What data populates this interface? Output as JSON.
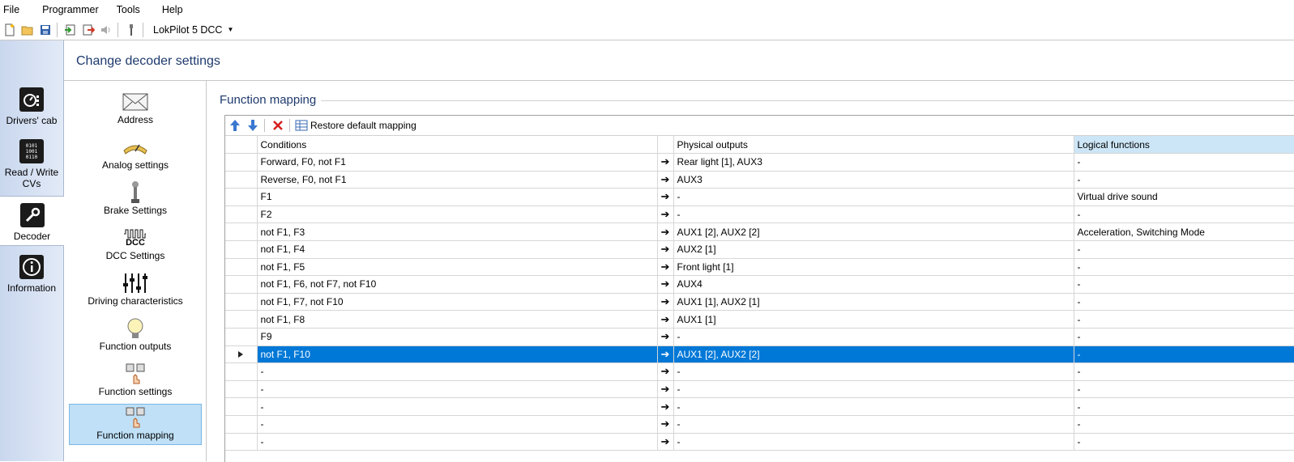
{
  "menu": [
    "File",
    "Programmer",
    "Tools",
    "Help"
  ],
  "toolbar": {
    "decoder_select": "LokPilot 5 DCC",
    "icons": [
      "new-file-icon",
      "open-folder-icon",
      "save-icon",
      "import-icon",
      "export-icon",
      "sound-icon",
      "wrench-probe-icon"
    ]
  },
  "leftnav": {
    "items": [
      {
        "label": "Drivers' cab",
        "icon": "drivers-cab-icon"
      },
      {
        "label": "Read / Write CVs",
        "icon": "binary-icon"
      },
      {
        "label": "Decoder",
        "icon": "wrench-icon"
      },
      {
        "label": "Information",
        "icon": "info-icon"
      }
    ],
    "active": "Decoder"
  },
  "header": {
    "title": "Change decoder settings"
  },
  "categories": [
    {
      "label": "Address",
      "icon": "envelope-icon"
    },
    {
      "label": "Analog settings",
      "icon": "analog-meter-icon"
    },
    {
      "label": "Brake Settings",
      "icon": "brake-lever-icon"
    },
    {
      "label": "DCC Settings",
      "icon": "dcc-icon",
      "icon_text": "DCC"
    },
    {
      "label": "Driving characteristics",
      "icon": "sliders-icon"
    },
    {
      "label": "Function outputs",
      "icon": "lightbulb-icon"
    },
    {
      "label": "Function settings",
      "icon": "function-hand-icon"
    },
    {
      "label": "Function mapping",
      "icon": "function-hand-icon"
    }
  ],
  "selected_category": "Function mapping",
  "section": {
    "title": "Function mapping"
  },
  "grid_toolbar": {
    "restore_label": "Restore default mapping"
  },
  "columns": {
    "conditions": "Conditions",
    "physical": "Physical outputs",
    "logical": "Logical functions"
  },
  "arrow_glyph": "➔",
  "rows": [
    {
      "conditions": "Forward, F0, not F1",
      "physical": "Rear light [1], AUX3",
      "logical": "-"
    },
    {
      "conditions": "Reverse, F0, not F1",
      "physical": "AUX3",
      "logical": "-"
    },
    {
      "conditions": "F1",
      "physical": "-",
      "logical": "Virtual drive sound"
    },
    {
      "conditions": "F2",
      "physical": "-",
      "logical": "-"
    },
    {
      "conditions": "not F1, F3",
      "physical": "AUX1 [2], AUX2 [2]",
      "logical": "Acceleration, Switching Mode"
    },
    {
      "conditions": "not F1, F4",
      "physical": "AUX2 [1]",
      "logical": "-"
    },
    {
      "conditions": "not F1, F5",
      "physical": "Front light [1]",
      "logical": "-"
    },
    {
      "conditions": "not F1, F6, not F7, not F10",
      "physical": "AUX4",
      "logical": "-"
    },
    {
      "conditions": "not F1, F7, not F10",
      "physical": "AUX1 [1], AUX2 [1]",
      "logical": "-"
    },
    {
      "conditions": "not F1, F8",
      "physical": "AUX1 [1]",
      "logical": "-"
    },
    {
      "conditions": "F9",
      "physical": "-",
      "logical": "-"
    },
    {
      "conditions": "not F1, F10",
      "physical": "AUX1 [2], AUX2 [2]",
      "logical": "-",
      "selected": true
    },
    {
      "conditions": "-",
      "physical": "-",
      "logical": "-"
    },
    {
      "conditions": "-",
      "physical": "-",
      "logical": "-"
    },
    {
      "conditions": "-",
      "physical": "-",
      "logical": "-"
    },
    {
      "conditions": "-",
      "physical": "-",
      "logical": "-"
    },
    {
      "conditions": "-",
      "physical": "-",
      "logical": "-"
    }
  ],
  "colors": {
    "selection": "#0078d7",
    "accent_title": "#1e3a6e",
    "category_selected": "#bfe0f7",
    "nav_gradient": "#c9d7ee"
  }
}
